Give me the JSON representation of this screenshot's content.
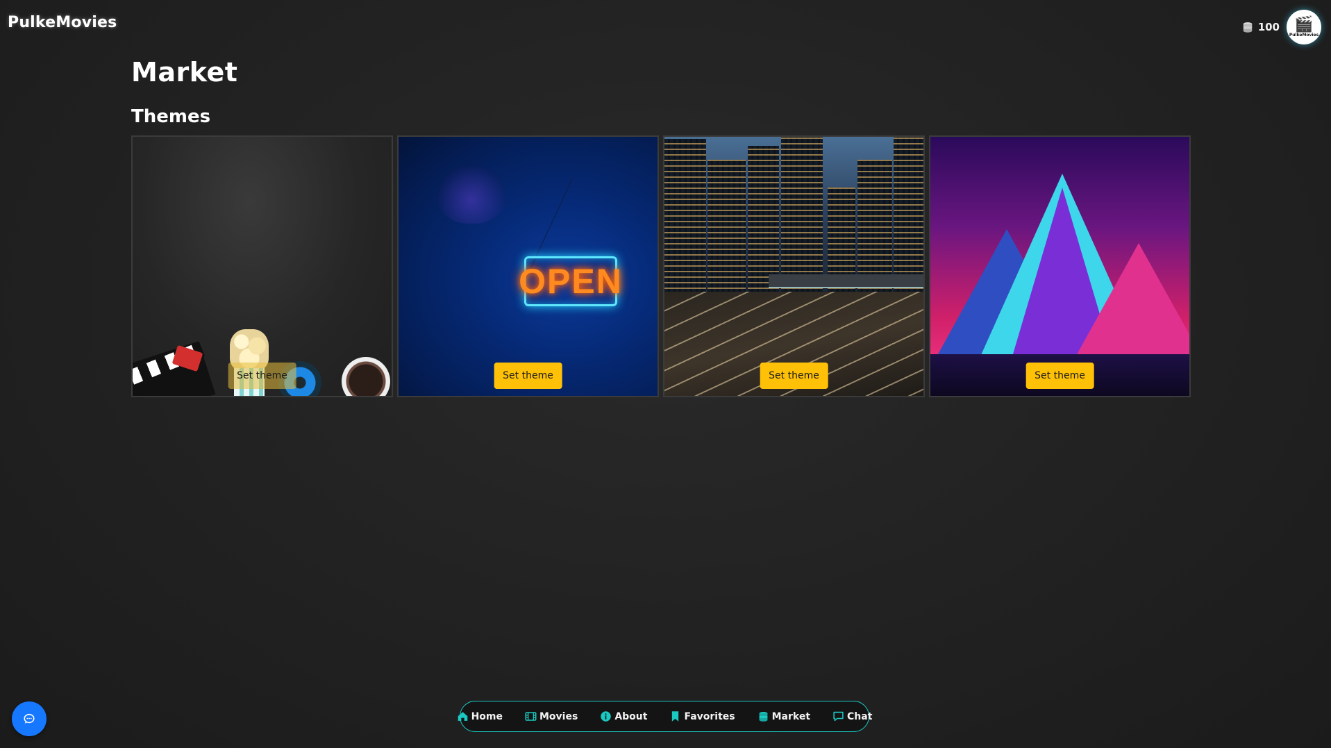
{
  "app": {
    "brand": "PulkeMovies"
  },
  "header": {
    "coins": "100",
    "avatar_label": "PulkeMovies"
  },
  "page": {
    "title": "Market",
    "section_title": "Themes"
  },
  "themes": [
    {
      "button_label": "Set theme",
      "scene": "movie-props"
    },
    {
      "button_label": "Set theme",
      "scene": "neon-open-sign",
      "sign_text": "OPEN"
    },
    {
      "button_label": "Set theme",
      "scene": "night-city"
    },
    {
      "button_label": "Set theme",
      "scene": "neon-mountains"
    }
  ],
  "nav": {
    "accent": "#19c9c2",
    "items": [
      {
        "label": "Home",
        "icon": "home-icon"
      },
      {
        "label": "Movies",
        "icon": "film-icon"
      },
      {
        "label": "About",
        "icon": "info-icon"
      },
      {
        "label": "Favorites",
        "icon": "bookmark-icon"
      },
      {
        "label": "Market",
        "icon": "coins-icon"
      },
      {
        "label": "Chat",
        "icon": "chat-icon"
      }
    ]
  },
  "colors": {
    "button": "#ffc107",
    "chat_fab": "#1677ff"
  }
}
